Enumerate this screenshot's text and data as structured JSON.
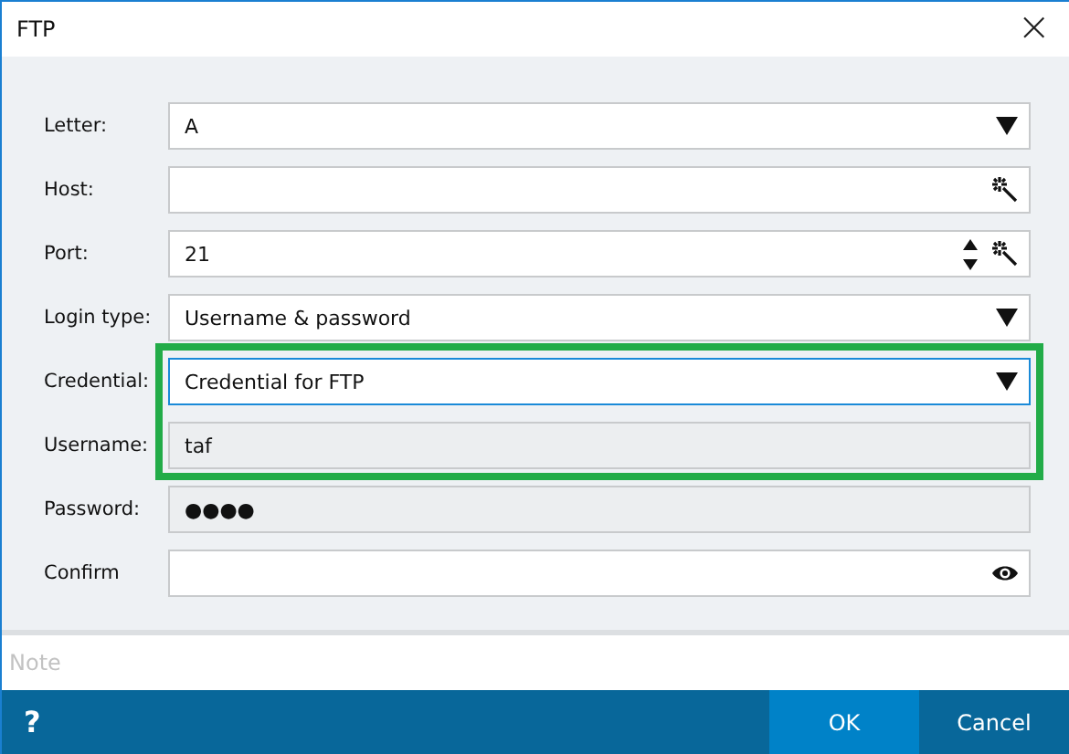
{
  "window": {
    "title": "FTP",
    "close": "×"
  },
  "rows": [
    {
      "kind": "dropdown",
      "label": "Letter:",
      "value": "A",
      "focused": false,
      "disabled": false
    },
    {
      "kind": "wand",
      "label": "Host:",
      "focused": false,
      "disabled": false
    },
    {
      "kind": "spinner",
      "label": "Port:",
      "value": "21",
      "focused": false,
      "disabled": false
    },
    {
      "kind": "dropdown",
      "label": "Login type:",
      "value": "Username & password",
      "focused": false,
      "disabled": false
    },
    {
      "kind": "highlight",
      "fields": [
        {
          "kind": "dropdown",
          "label": "Credential:",
          "value": "Credential for FTP",
          "focused": true,
          "disabled": false
        },
        {
          "kind": "text",
          "label": "Username:",
          "value": "taf",
          "focused": false,
          "disabled": true
        }
      ]
    },
    {
      "kind": "text",
      "label": "Password:",
      "value": "●●●●",
      "focused": false,
      "disabled": true
    },
    {
      "kind": "reveal",
      "label": "Confirm",
      "focused": false,
      "disabled": false
    }
  ],
  "note": {
    "placeholder": "Note"
  },
  "footer": {
    "help": "?",
    "buttons": [
      {
        "label": "OK",
        "selected": true
      },
      {
        "label": "Cancel",
        "selected": false
      }
    ]
  }
}
